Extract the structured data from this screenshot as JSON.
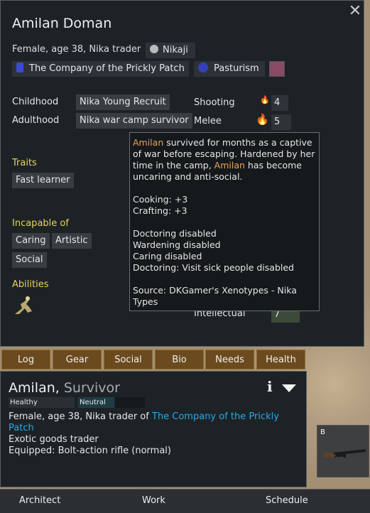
{
  "pawn": {
    "name": "Amilan Doman",
    "description": "Female, age 38, Nika trader",
    "ideoligion": "Nikaji",
    "faction": "The Company of the Prickly Patch",
    "culture": "Pasturism",
    "close_label": "✕"
  },
  "backstory": {
    "childhood_label": "Childhood",
    "childhood_value": "Nika Young Recruit",
    "adulthood_label": "Adulthood",
    "adulthood_value": "Nika war camp survivor"
  },
  "skills": {
    "shooting_label": "Shooting",
    "shooting_value": "4",
    "melee_label": "Melee",
    "melee_value": "5",
    "intellectual_label": "Intellectual",
    "intellectual_value": "7"
  },
  "traits": {
    "heading": "Traits",
    "items": [
      "Fast learner"
    ]
  },
  "incapable": {
    "heading": "Incapable of",
    "items": [
      "Caring",
      "Artistic",
      "Social"
    ]
  },
  "abilities": {
    "heading": "Abilities"
  },
  "tooltip": {
    "name1": "Amilan",
    "text1": " survived for months as a captive of war before escaping. Hardened by her time in the camp, ",
    "name2": "Amilan",
    "text2": " has become uncaring and anti-social.",
    "cooking": "Cooking: +3",
    "crafting": "Crafting: +3",
    "disabled1": "Doctoring disabled",
    "disabled2": "Wardening disabled",
    "disabled3": "Caring disabled",
    "disabled4": "Doctoring: Visit sick people disabled",
    "source": "Source: DKGamer's Xenotypes - Nika Types"
  },
  "tabs": [
    "Log",
    "Gear",
    "Social",
    "Bio",
    "Needs",
    "Health"
  ],
  "inspect": {
    "name": "Amilan",
    "title": "Survivor",
    "health_label": "Healthy",
    "mood_label": "Neutral",
    "line1_prefix": "Female, age 38, Nika trader of ",
    "faction_link": "The Company of the Prickly Patch",
    "line2": "Exotic goods trader",
    "line3": "Equipped: Bolt-action rifle (normal)",
    "weapon_letter": "B",
    "mood_level": 0.55
  },
  "bottom": [
    "Architect",
    "Work",
    "Schedule"
  ],
  "colors": {
    "accent_yellow": "#e6d35a",
    "link_blue": "#2aa8e6",
    "tab_brown": "#6b4a1e",
    "name_orange": "#e8a35a"
  }
}
